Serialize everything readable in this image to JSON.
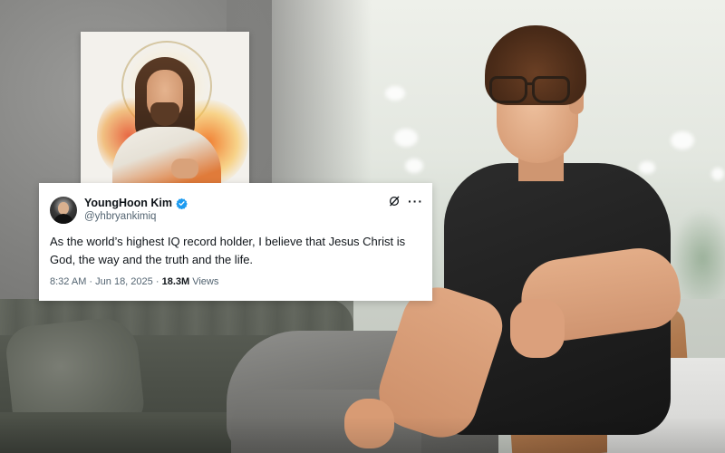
{
  "tweet": {
    "display_name": "YoungHoon Kim",
    "handle": "@yhbryankimiq",
    "text": "As the world’s highest IQ record holder, I believe that Jesus Christ is God, the way and the truth and the life.",
    "time": "8:32 AM",
    "separator": "·",
    "date": "Jun 18, 2025",
    "views_count": "18.3M",
    "views_label": "Views",
    "more_label": "···",
    "verified_color": "#1d9bf0"
  }
}
